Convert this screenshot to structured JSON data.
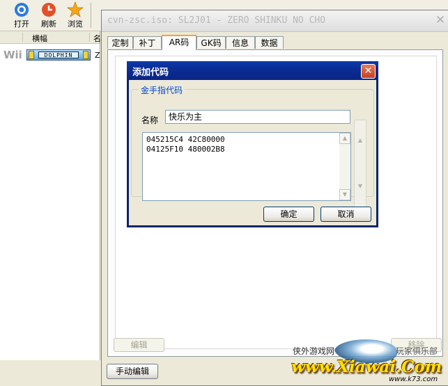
{
  "toolbar": {
    "buttons": [
      {
        "label": "打开",
        "icon": "open-icon"
      },
      {
        "label": "刷新",
        "icon": "refresh-icon"
      },
      {
        "label": "浏览",
        "icon": "browse-icon"
      }
    ]
  },
  "gamelist": {
    "columns": [
      "横幅",
      "名"
    ],
    "rows": [
      {
        "platform": "Wii",
        "banner_text": "DOLPHIN",
        "name_fragment": "Z"
      }
    ]
  },
  "props_window": {
    "title": "cvn-zsc.iso: SL2J01 - ZERO SHINKU NO CHO",
    "tabs": [
      "定制",
      "补丁",
      "AR码",
      "GK码",
      "信息",
      "数据"
    ],
    "active_tab": "AR码",
    "edit_button": "编辑",
    "manual_edit_button": "手动编辑",
    "remove_button": "移除"
  },
  "dialog": {
    "title": "添加代码",
    "group_title": "金手指代码",
    "name_label": "名称",
    "name_value": "快乐为主",
    "code_lines": [
      "045215C4 42C80000",
      "04125F10 480002B8"
    ],
    "ok_label": "确定",
    "cancel_label": "取消"
  },
  "watermark": {
    "left_text": "侠外游戏网",
    "right_text": "玩家俱乐部",
    "logo_text": "www.Xiawai.Com",
    "url_text": "www.k73.com"
  },
  "colors": {
    "dialog_title": "#0a246a",
    "dialog_close": "#c4401e",
    "active_tab_accent": "#f5a622",
    "group_title": "#0046d5"
  }
}
